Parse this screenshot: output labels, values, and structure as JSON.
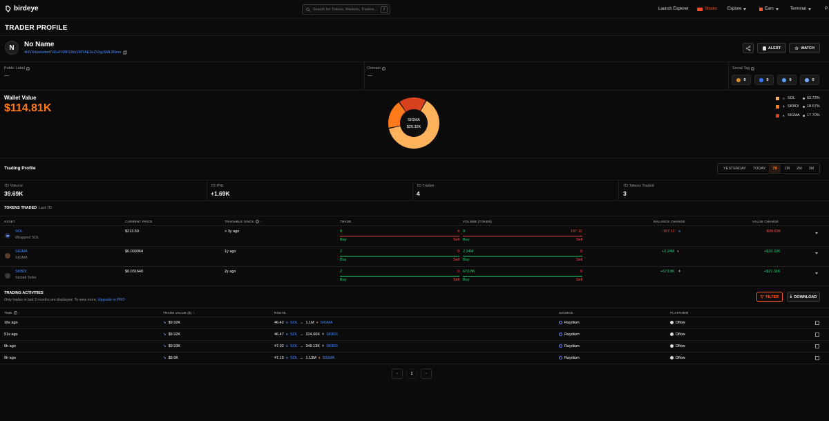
{
  "navbar": {
    "brand": "birdeye",
    "search_placeholder": "Search for Tokens, Markets, Traders...",
    "search_shortcut": "/",
    "items": {
      "launch_explorer": "Launch Explorer",
      "stocks": "Stocks",
      "explore": "Explore",
      "earn": "Earn",
      "terminal": "Terminal",
      "cut": "P"
    }
  },
  "page": {
    "title": "TRADER PROFILE"
  },
  "profile": {
    "initial": "N",
    "name": "No Name",
    "address": "4HVX4zehebetToDuFXBFSWv1WYAE3eZVhjySML8Nrss",
    "alert_label": "ALERT",
    "watch_label": "WATCH"
  },
  "labels": {
    "public_label": "Public Label",
    "public_value": "—",
    "domain": "Domain",
    "domain_value": "—",
    "social_tag": "Social Tag",
    "social_counts": [
      "0",
      "0",
      "0",
      "0"
    ]
  },
  "wallet": {
    "title": "Wallet Value",
    "value": "$114.81K",
    "donut_center_name": "SIGMA",
    "donut_center_value": "$20.32K",
    "legend": [
      {
        "name": "SOL",
        "pct": "63.73%",
        "share": 63.73,
        "color": "#ffb25c"
      },
      {
        "name": "SKBDI",
        "pct": "18.57%",
        "share": 18.57,
        "color": "#ff7a1a"
      },
      {
        "name": "SIGMA",
        "pct": "17.70%",
        "share": 17.7,
        "color": "#d9411e"
      }
    ]
  },
  "trading_profile": {
    "title": "Trading Profile",
    "ranges": [
      "YESTERDAY",
      "TODAY",
      "7D",
      "1M",
      "2M",
      "3M"
    ],
    "active_range": "7D",
    "stats": [
      {
        "label": "7D Volume",
        "value": "39.69K",
        "tone": "white"
      },
      {
        "label": "7D PNL",
        "value": "+1.69K",
        "tone": "green"
      },
      {
        "label": "7D Trades",
        "value": "4",
        "tone": "white"
      },
      {
        "label": "7D Tokens Traded",
        "value": "3",
        "tone": "white"
      }
    ]
  },
  "tokens_traded": {
    "title": "TOKENS TRADED",
    "subtitle": "Last 7D",
    "headers": {
      "asset": "ASSET",
      "current_price": "CURRENT PRICE",
      "tradable_since": "TRADABLE SINCE",
      "trade": "TRADE",
      "volume": "VOLUME (TOKEN)",
      "balance_change": "BALANCE CHANGE",
      "value_change": "VALUE CHANGE"
    },
    "rows": [
      {
        "symbol": "SOL",
        "name": "Wrapped SOL",
        "price": "$213.50",
        "since": "> 3y ago",
        "buy_count": "0",
        "sell_count": "4",
        "buy_vol": "0",
        "sell_vol": "187.12",
        "buy_label": "Buy",
        "sell_label": "Sell",
        "balance": "-187.12",
        "value": "-$39.93K",
        "icon_color": "#3a6df0"
      },
      {
        "symbol": "SIGMA",
        "name": "SIGMA",
        "price": "$0.009064",
        "since": "1y ago",
        "buy_count": "2",
        "sell_count": "0",
        "buy_vol": "2.24M",
        "sell_vol": "0",
        "buy_label": "Buy",
        "sell_label": "Sell",
        "balance": "+2.24M",
        "value": "+$20.32K",
        "icon_color": "#8a5a3a"
      },
      {
        "symbol": "SKBDI",
        "name": "Skibidi Toilet",
        "price": "$0.031640",
        "since": "2y ago",
        "buy_count": "2",
        "sell_count": "0",
        "buy_vol": "673.8K",
        "sell_vol": "0",
        "buy_label": "Buy",
        "sell_label": "Sell",
        "balance": "+673.8K",
        "value": "+$21.31K",
        "icon_color": "#777777"
      }
    ]
  },
  "activities": {
    "title": "TRADING ACTIVITIES",
    "subtitle": "Only trades in last 3 months are displayed. To view more,",
    "upgrade": "Upgrade to PRO",
    "filter_label": "FILTER",
    "download_label": "DOWNLOAD",
    "headers": {
      "time": "TIME",
      "trade_value": "TRADE VALUE ($)",
      "route": "ROUTE",
      "source": "SOURCE",
      "platform": "PLATFORM"
    },
    "rows": [
      {
        "time": "16s ago",
        "value": "$9.92K",
        "from_amt": "46.42",
        "from_sym": "SOL",
        "arrow": "→",
        "to_amt": "1.1M",
        "to_sym": "SIGMA",
        "source": "Raydium",
        "platform": "Dflow"
      },
      {
        "time": "51s ago",
        "value": "$9.92K",
        "from_amt": "46.47",
        "from_sym": "SOL",
        "arrow": "→",
        "to_amt": "324.66K",
        "to_sym": "SKBDI",
        "source": "Raydium",
        "platform": "Dflow"
      },
      {
        "time": "6h ago",
        "value": "$9.93K",
        "from_amt": "47.02",
        "from_sym": "SOL",
        "arrow": "→",
        "to_amt": "349.13K",
        "to_sym": "SKBDI",
        "source": "Raydium",
        "platform": "Dflow"
      },
      {
        "time": "6h ago",
        "value": "$9.9K",
        "from_amt": "47.19",
        "from_sym": "SOL",
        "arrow": "→",
        "to_amt": "1.13M",
        "to_sym": "SIGMA",
        "source": "Raydium",
        "platform": "Dflow"
      }
    ]
  },
  "pagination": {
    "prev": "‹",
    "page": "1",
    "next": "›"
  }
}
